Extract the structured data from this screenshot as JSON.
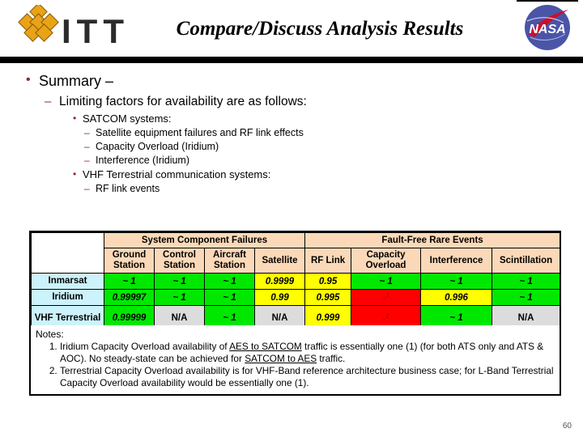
{
  "header": {
    "title": "Compare/Discuss Analysis Results",
    "left_logo_text": "ITT",
    "left_logo_icon": "itt-diamond-logo",
    "right_logo_icon": "nasa-meatball-logo",
    "right_logo_text": "NASA"
  },
  "bullets": {
    "l1": "Summary –",
    "l2": "Limiting factors for availability are as follows:",
    "l3a": "SATCOM systems:",
    "l4a": "Satellite equipment failures and RF link effects",
    "l4b": "Capacity Overload (Iridium)",
    "l4c": "Interference (Iridium)",
    "l3b": "VHF Terrestrial communication systems:",
    "l4d": "RF link events"
  },
  "table": {
    "corner_label": "",
    "groups": [
      {
        "label": "System Component Failures",
        "span": 4
      },
      {
        "label": "Fault-Free Rare Events",
        "span": 4
      }
    ],
    "columns": [
      "Ground Station",
      "Control Station",
      "Aircraft Station",
      "Satellite",
      "RF Link",
      "Capacity Overload",
      "Interference",
      "Scintillation"
    ],
    "rows": [
      {
        "label": "Inmarsat",
        "cells": [
          {
            "value": "~ 1",
            "status": "green"
          },
          {
            "value": "~ 1",
            "status": "green"
          },
          {
            "value": "~ 1",
            "status": "green"
          },
          {
            "value": "0.9999",
            "status": "yellow"
          },
          {
            "value": "0.95",
            "status": "yellow"
          },
          {
            "value": "~ 1",
            "status": "green"
          },
          {
            "value": "~ 1",
            "status": "green"
          },
          {
            "value": "~ 1",
            "status": "green"
          }
        ]
      },
      {
        "label": "Iridium",
        "cells": [
          {
            "value": "0.99997",
            "status": "green"
          },
          {
            "value": "~ 1",
            "status": "green"
          },
          {
            "value": "~ 1",
            "status": "green"
          },
          {
            "value": "0.99",
            "status": "yellow"
          },
          {
            "value": "0.995",
            "status": "yellow"
          },
          {
            "value": "-",
            "status": "red",
            "footnote": "1"
          },
          {
            "value": "0.996",
            "status": "yellow"
          },
          {
            "value": "~ 1",
            "status": "green"
          }
        ]
      },
      {
        "label": "VHF Terrestrial",
        "cells": [
          {
            "value": "0.99999",
            "status": "green"
          },
          {
            "value": "N/A",
            "status": "gray"
          },
          {
            "value": "~ 1",
            "status": "green"
          },
          {
            "value": "N/A",
            "status": "gray"
          },
          {
            "value": "0.999",
            "status": "yellow"
          },
          {
            "value": "-",
            "status": "red",
            "footnote": "2"
          },
          {
            "value": "~ 1",
            "status": "green"
          },
          {
            "value": "N/A",
            "status": "gray"
          }
        ]
      }
    ]
  },
  "notes": {
    "title": "Notes:",
    "items": [
      "Iridium Capacity Overload availability of AES to SATCOM traffic is essentially one (1) (for both ATS only and ATS & AOC). No steady-state can be achieved for SATCOM to AES traffic.",
      "Terrestrial Capacity Overload availability is for VHF-Band reference architecture business case; for L-Band Terrestrial Capacity Overload availability would be essentially one (1)."
    ]
  },
  "footer": {
    "page_number": "60"
  },
  "colors": {
    "header_fill": "#fbd9b8",
    "rowlabel_fill": "#ccf2fb",
    "green": "#00e800",
    "yellow": "#ffff00",
    "red": "#fe0000",
    "gray": "#dcdcdc",
    "bullet_marker": "#8c2b2b",
    "itt_gold": "#e8a317",
    "nasa_blue": "#4a55a8",
    "nasa_red": "#c8102e"
  }
}
